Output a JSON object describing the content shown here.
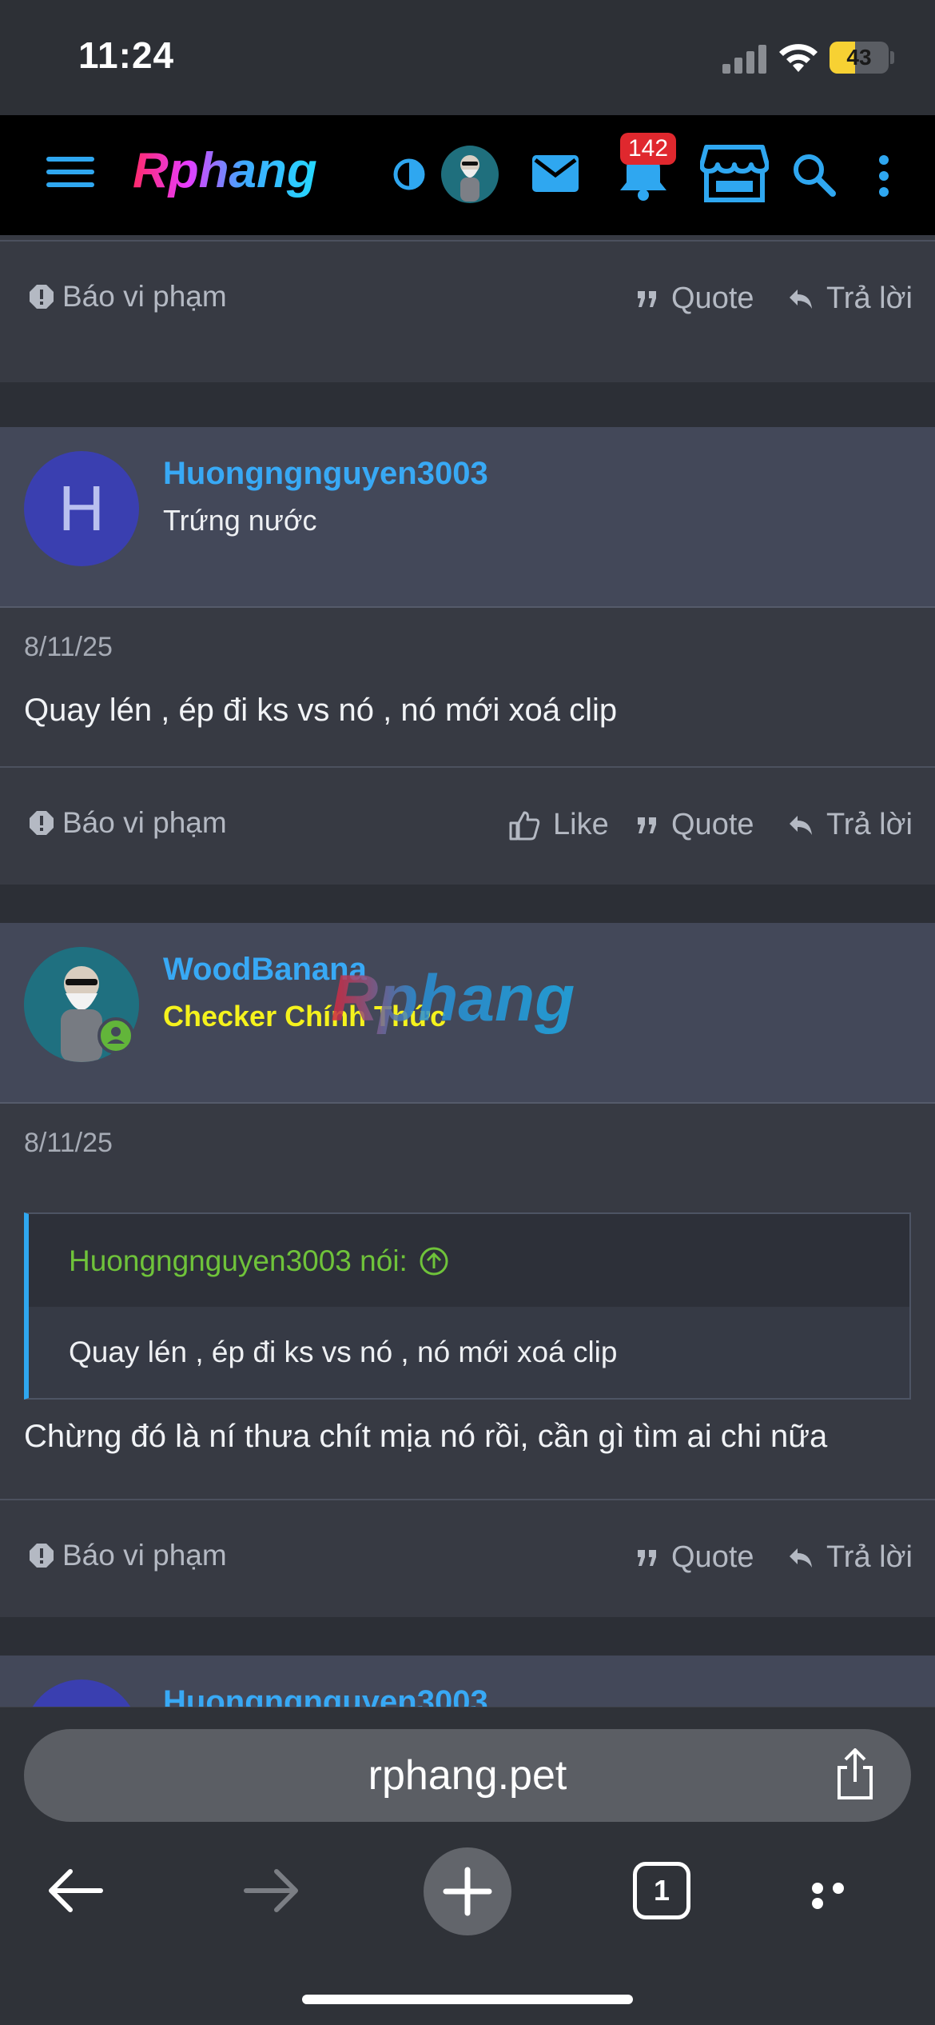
{
  "status_bar": {
    "time": "11:24",
    "battery": "43",
    "battery_level": 0.43
  },
  "header": {
    "logo": "Rphang",
    "notification_count": "142",
    "accent_color": "#2fa7f0"
  },
  "posts": [
    {
      "report_label": "Báo vi phạm",
      "quote_label": "Quote",
      "reply_label": "Trả lời"
    },
    {
      "avatar_letter": "H",
      "username": "Huongngnguyen3003",
      "user_title": "Trứng nước",
      "date": "8/11/25",
      "text": "Quay lén , ép đi ks vs nó , nó mới xoá clip",
      "report_label": "Báo vi phạm",
      "like_label": "Like",
      "quote_label": "Quote",
      "reply_label": "Trả lời"
    },
    {
      "username": "WoodBanana",
      "user_title": "Checker Chính Thức",
      "date": "8/11/25",
      "quote_author": "Huongngnguyen3003 nói:",
      "quote_text": "Quay lén , ép đi ks vs nó , nó mới xoá clip",
      "text": "Chừng đó là ní thưa chít mịa nó rồi, cần gì tìm ai chi nữa",
      "report_label": "Báo vi phạm",
      "quote_label": "Quote",
      "reply_label": "Trả lời"
    },
    {
      "username": "Huongngnguyen3003"
    }
  ],
  "browser": {
    "url": "rphang.pet",
    "tab_count": "1"
  }
}
